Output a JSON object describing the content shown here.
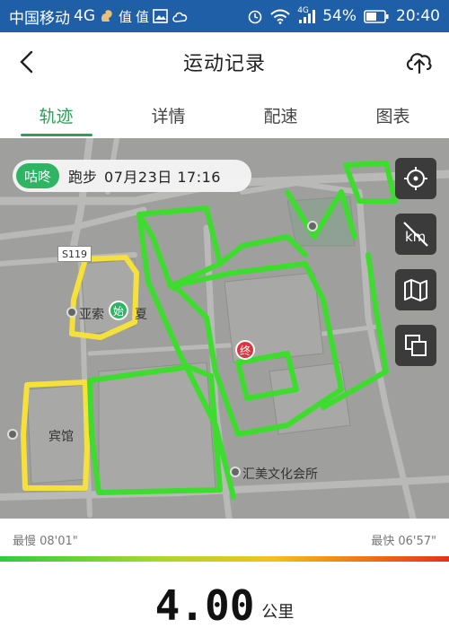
{
  "status_bar": {
    "carrier": "中国移动",
    "network": "4G",
    "app_badge_1": "值",
    "app_badge_2": "值",
    "signal_label": "4G",
    "battery": "54%",
    "time": "20:40"
  },
  "header": {
    "title": "运动记录"
  },
  "tabs": [
    {
      "label": "轨迹",
      "active": true
    },
    {
      "label": "详情",
      "active": false
    },
    {
      "label": "配速",
      "active": false
    },
    {
      "label": "图表",
      "active": false
    }
  ],
  "map": {
    "brand": "咕咚",
    "activity": "跑步",
    "datetime": "07月23日 17:16",
    "start_marker": "始",
    "end_marker": "终",
    "road_shield": "S119",
    "labels": {
      "building_1": "亚索",
      "building_1b": "夏",
      "hotel": "宾馆",
      "club": "汇美文化会所"
    }
  },
  "pace": {
    "slowest": "最慢 08'01\"",
    "fastest": "最快 06'57\""
  },
  "distance": {
    "value": "4.00",
    "unit": "公里"
  },
  "colors": {
    "status_bar": "#1f5fa8",
    "accent": "#2e9e58",
    "track_fast": "#3ddc2f",
    "track_slow": "#f5e13a"
  }
}
